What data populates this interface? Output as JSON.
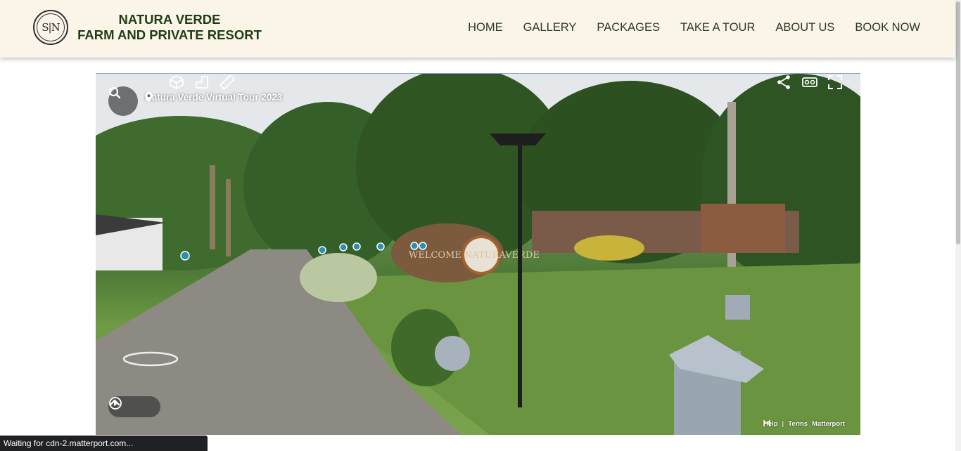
{
  "brand": {
    "line1": "NATURA VERDE",
    "line2": "FARM AND PRIVATE RESORT",
    "logo_text": "S|N"
  },
  "nav": {
    "items": [
      "HOME",
      "GALLERY",
      "PACKAGES",
      "TAKE A TOUR",
      "ABOUT US",
      "BOOK NOW"
    ]
  },
  "tour": {
    "title": "Natura Verde Virtual Tour 2023",
    "sign_text": "WELCOME NATURAVERDE",
    "footer": {
      "help": "Help",
      "sep": "|",
      "terms": "Terms",
      "brand": "Matterport"
    },
    "icons": [
      "search-icon",
      "chevron-up-icon",
      "play-icon",
      "dollhouse-icon",
      "floorplan-icon",
      "measure-icon",
      "share-icon",
      "vr-icon",
      "fullscreen-icon"
    ]
  },
  "status": {
    "text": "Waiting for cdn-2.matterport.com..."
  },
  "colors": {
    "header_bg": "#fbf4e8",
    "brand_text": "#1f3d12",
    "nav_text": "#2b3b22"
  }
}
